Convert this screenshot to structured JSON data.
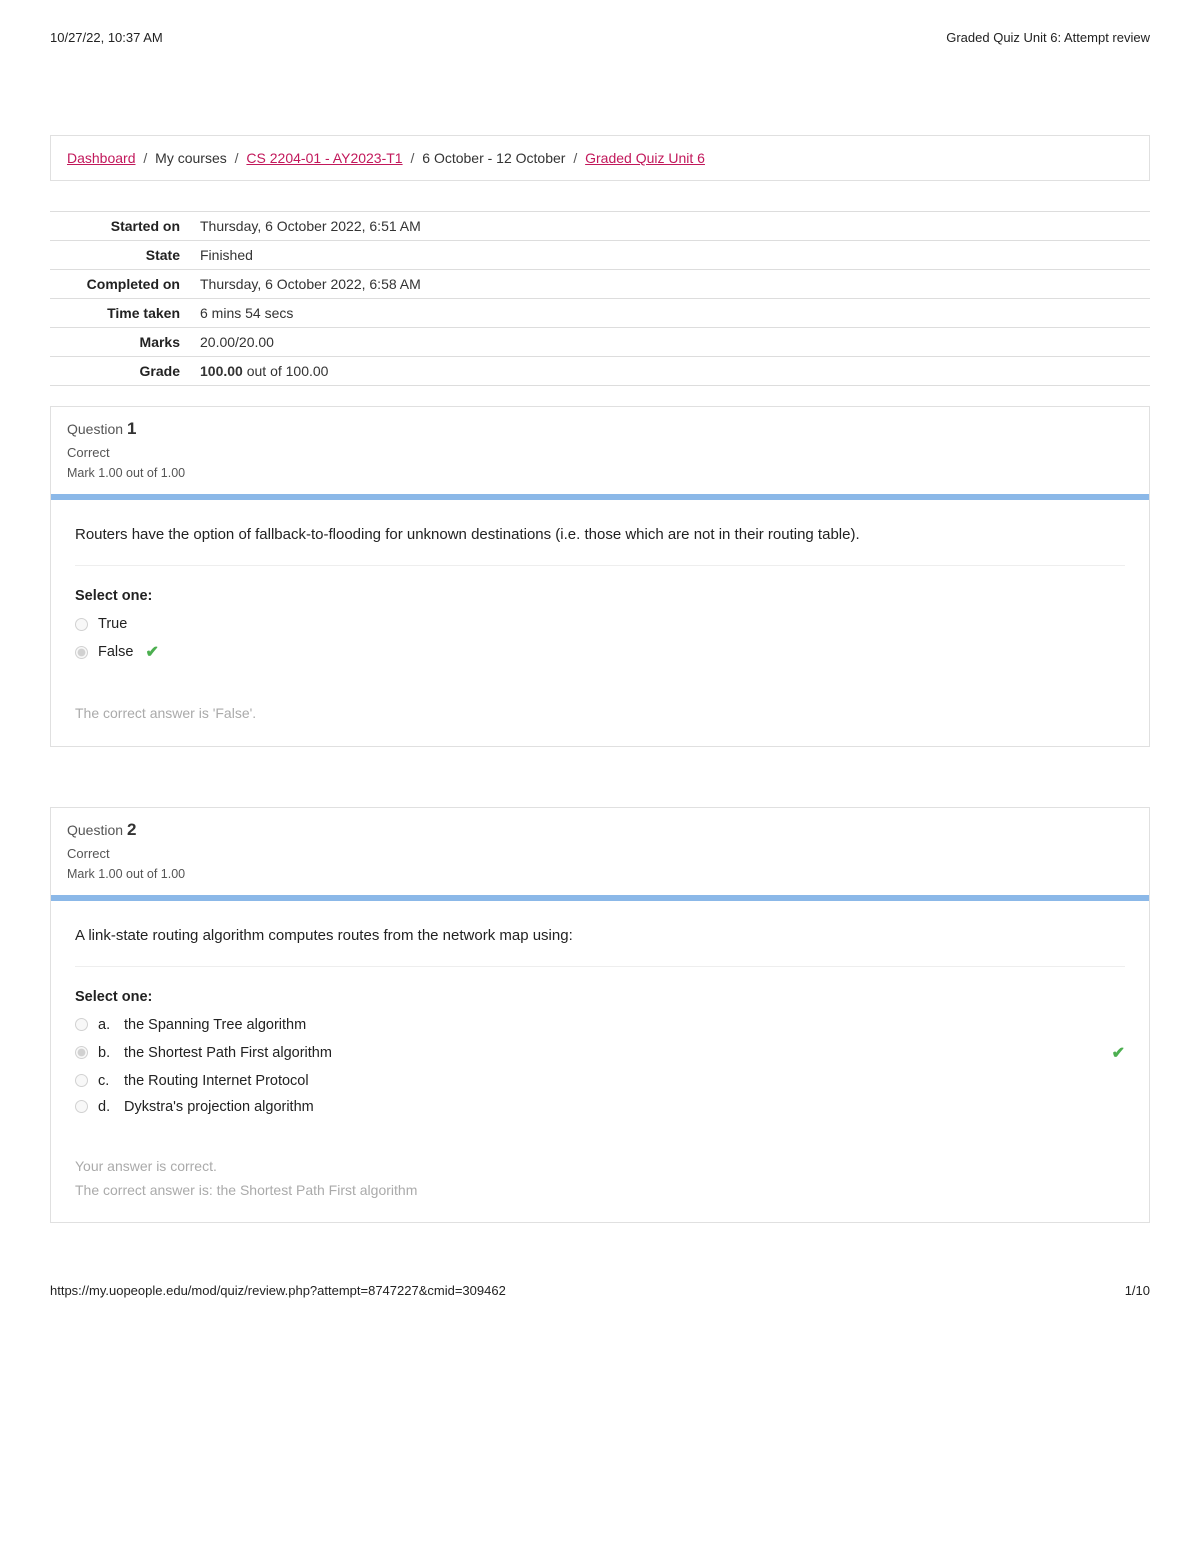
{
  "print": {
    "timestamp": "10/27/22, 10:37 AM",
    "doc_title": "Graded Quiz Unit 6: Attempt review",
    "footer_url": "https://my.uopeople.edu/mod/quiz/review.php?attempt=8747227&cmid=309462",
    "page_num": "1/10"
  },
  "breadcrumb": {
    "dashboard": "Dashboard",
    "my_courses": "My courses",
    "course": "CS 2204-01 - AY2023-T1",
    "section": "6 October - 12 October",
    "quiz": "Graded Quiz Unit 6"
  },
  "summary": {
    "rows": [
      {
        "label": "Started on",
        "value": "Thursday, 6 October 2022, 6:51 AM"
      },
      {
        "label": "State",
        "value": "Finished"
      },
      {
        "label": "Completed on",
        "value": "Thursday, 6 October 2022, 6:58 AM"
      },
      {
        "label": "Time taken",
        "value": "6 mins 54 secs"
      },
      {
        "label": "Marks",
        "value": "20.00/20.00"
      }
    ],
    "grade_label": "Grade",
    "grade_bold": "100.00",
    "grade_rest": " out of 100.00"
  },
  "questions": [
    {
      "title_prefix": "Question",
      "number": "1",
      "status": "Correct",
      "mark": "Mark 1.00 out of 1.00",
      "text": "Routers have the option of fallback-to-flooding for unknown destinations (i.e. those which are not in their routing table).",
      "select_label": "Select one:",
      "type": "truefalse",
      "options": [
        {
          "label": "True",
          "selected": false,
          "correct": false
        },
        {
          "label": "False",
          "selected": true,
          "correct": true
        }
      ],
      "feedback": [
        "The correct answer is 'False'."
      ]
    },
    {
      "title_prefix": "Question",
      "number": "2",
      "status": "Correct",
      "mark": "Mark 1.00 out of 1.00",
      "text": "A link-state routing algorithm computes routes from the network map using:",
      "select_label": "Select one:",
      "type": "mc",
      "options": [
        {
          "letter": "a.",
          "label": "the Spanning Tree algorithm",
          "selected": false,
          "correct": false
        },
        {
          "letter": "b.",
          "label": "the Shortest Path First algorithm",
          "selected": true,
          "correct": true
        },
        {
          "letter": "c.",
          "label": "the Routing Internet Protocol",
          "selected": false,
          "correct": false
        },
        {
          "letter": "d.",
          "label": "Dykstra's projection algorithm",
          "selected": false,
          "correct": false
        }
      ],
      "feedback": [
        "Your answer is correct.",
        "The correct answer is: the Shortest Path First algorithm"
      ]
    }
  ]
}
